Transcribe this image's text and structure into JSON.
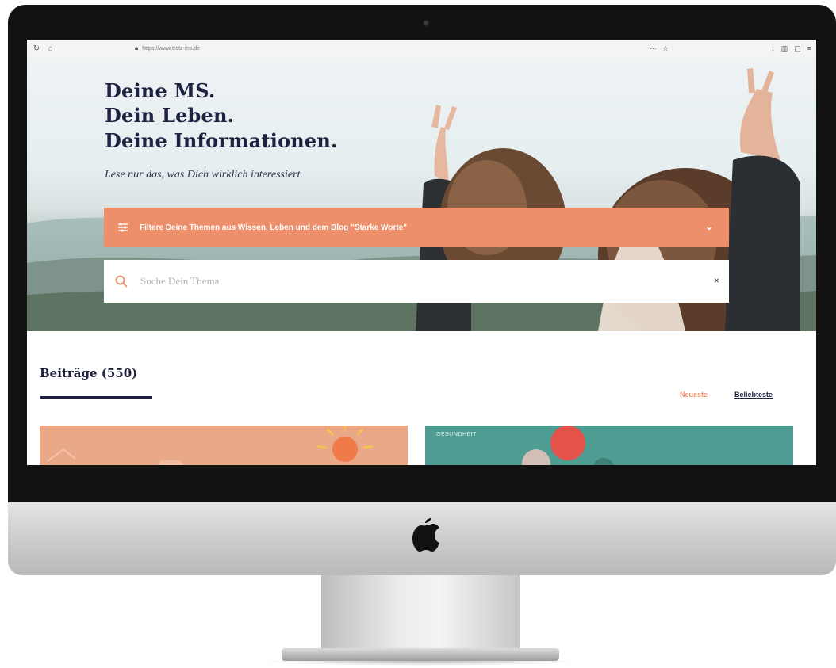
{
  "browser": {
    "url": "https://www.trotz-ms.de"
  },
  "hero": {
    "title_lines": [
      "Deine MS.",
      "Dein Leben.",
      "Deine Informationen."
    ],
    "subtitle": "Lese nur das, was Dich wirklich interessiert.",
    "filter_label": "Filtere Deine Themen aus Wissen, Leben und dem Blog \"Starke Worte\"",
    "search_placeholder": "Suche Dein Thema",
    "clear_symbol": "×"
  },
  "posts": {
    "title": "Beiträge (550)",
    "sort_options": [
      "Neueste",
      "Beliebteste"
    ],
    "cards": [
      {
        "tag": ""
      },
      {
        "tag": "GESUNDHEIT"
      }
    ]
  },
  "colors": {
    "accent": "#ec8f6a",
    "navy": "#1e2140",
    "teal": "#4f9c93"
  },
  "icons": [
    "reload-icon",
    "home-icon",
    "lock-icon",
    "sliders-icon",
    "chevron-down-icon",
    "search-icon",
    "close-icon",
    "apple-logo"
  ]
}
